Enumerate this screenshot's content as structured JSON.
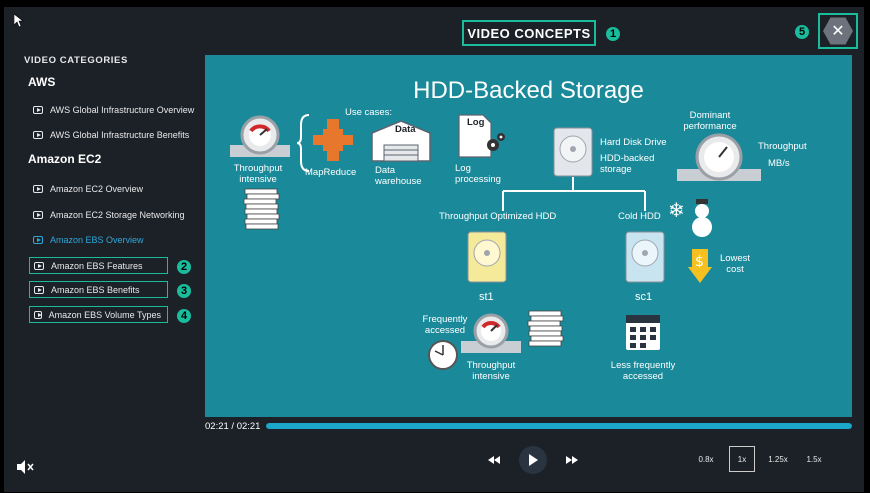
{
  "header": {
    "title": "VIDEO CONCEPTS",
    "title_badge": "1",
    "close_badge": "5",
    "close_icon": "close-icon"
  },
  "sidebar": {
    "heading": "VIDEO CATEGORIES",
    "groups": [
      {
        "title": "AWS",
        "items": [
          {
            "label": "AWS Global Infrastructure Overview"
          },
          {
            "label": "AWS Global Infrastructure Benefits"
          }
        ]
      },
      {
        "title": "Amazon EC2",
        "items": [
          {
            "label": "Amazon EC2 Overview"
          },
          {
            "label": "Amazon EC2 Storage Networking"
          },
          {
            "label": "Amazon EBS Overview",
            "active": true
          },
          {
            "label": "Amazon EBS Features",
            "badge": "2"
          },
          {
            "label": "Amazon EBS Benefits",
            "badge": "3"
          },
          {
            "label": "Amazon EBS Volume Types",
            "badge": "4"
          }
        ]
      }
    ]
  },
  "slide": {
    "title": "HDD-Backed Storage",
    "use_cases": "Use cases:",
    "throughput_intensive": "Throughput intensive",
    "mapreduce": "MapReduce",
    "data": "Data",
    "data_warehouse": "Data warehouse",
    "log": "Log",
    "log_processing": "Log processing",
    "hdd": "Hard Disk Drive",
    "hdd_backed": "HDD-backed storage",
    "dominant": "Dominant performance",
    "throughput": "Throughput",
    "mbs": "MB/s",
    "thr_opt": "Throughput Optimized HDD",
    "cold_hdd": "Cold HDD",
    "st1": "st1",
    "sc1": "sc1",
    "lowest_cost": "Lowest cost",
    "dollar": "$",
    "freq": "Frequently accessed",
    "thr_int2": "Throughput intensive",
    "less_freq": "Less frequently accessed"
  },
  "player": {
    "time": "02:21 / 02:21",
    "progress_fraction": 1.0,
    "speeds": [
      "0.8x",
      "1x",
      "1.25x",
      "1.5x"
    ],
    "selected_speed": "1x",
    "accent": "#1abc9c",
    "progress_color": "#1aa7c9"
  }
}
